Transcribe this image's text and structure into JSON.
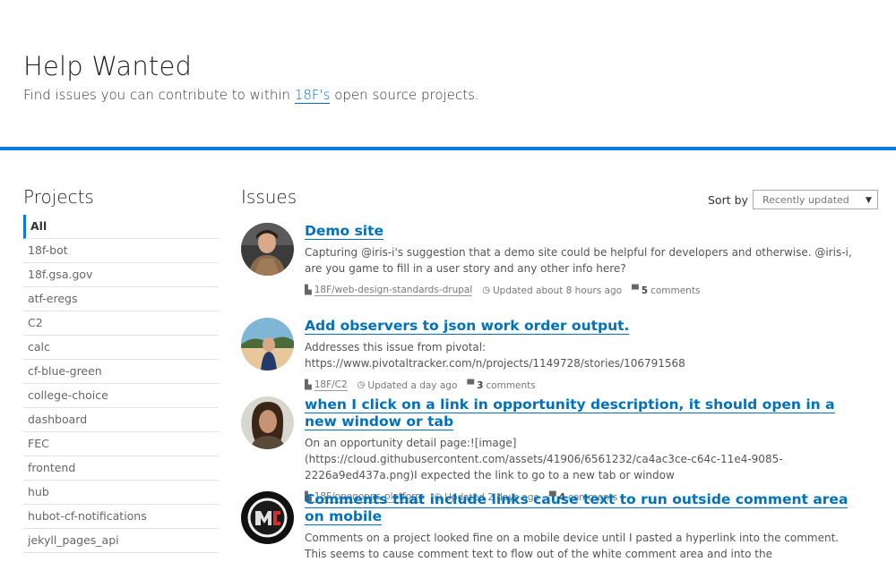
{
  "header": {
    "title": "Help Wanted",
    "subtitle_pre": "Find issues you can contribute to within ",
    "subtitle_link": "18F's",
    "subtitle_post": " open source projects."
  },
  "projects": {
    "heading": "Projects",
    "items": [
      "All",
      "18f-bot",
      "18f.gsa.gov",
      "atf-eregs",
      "C2",
      "calc",
      "cf-blue-green",
      "college-choice",
      "dashboard",
      "FEC",
      "frontend",
      "hub",
      "hubot-cf-notifications",
      "jekyll_pages_api"
    ]
  },
  "issues": {
    "heading": "Issues",
    "sort_label": "Sort by",
    "sort_value": "Recently updated",
    "list": [
      {
        "title": "Demo site",
        "desc": "Capturing @iris-i's suggestion that a demo site could be helpful for developers and otherwise. @iris-i, are you game to fill in a user story and any other info here?",
        "repo": "18F/web-design-standards-drupal",
        "updated": "Updated about 8 hours ago",
        "comments_count": "5",
        "comments_label": "comments"
      },
      {
        "title": "Add observers to json work order output.",
        "desc": "Addresses this issue from pivotal: https://www.pivotaltracker.com/n/projects/1149728/stories/106791568",
        "repo": "18F/C2",
        "updated": "Updated a day ago",
        "comments_count": "3",
        "comments_label": "comments"
      },
      {
        "title": "when I click on a link in opportunity description, it should open in a new window or tab",
        "desc": "On an opportunity detail page:![image](https://cloud.githubusercontent.com/assets/41906/6561232/ca4ac3ce-c64c-11e4-9085-2226a9ed437a.png)I expected the link to go to a new tab or window",
        "repo": "18F/openopps-platform",
        "updated": "Updated 2 days ago",
        "comments_count": "4",
        "comments_label": "comments"
      },
      {
        "title": "Comments that include links cause text to run outside comment area on mobile",
        "desc": "Comments on a project looked fine on a mobile device until I pasted a hyperlink into the comment. This seems to cause comment text to flow out of the white comment area and into the",
        "repo": "",
        "updated": "",
        "comments_count": "",
        "comments_label": ""
      }
    ]
  },
  "colors": {
    "accent": "#0b79e0",
    "link": "#0071bc"
  },
  "icons": [
    "repo-icon",
    "clock-icon",
    "comment-icon",
    "caret-down-icon"
  ]
}
